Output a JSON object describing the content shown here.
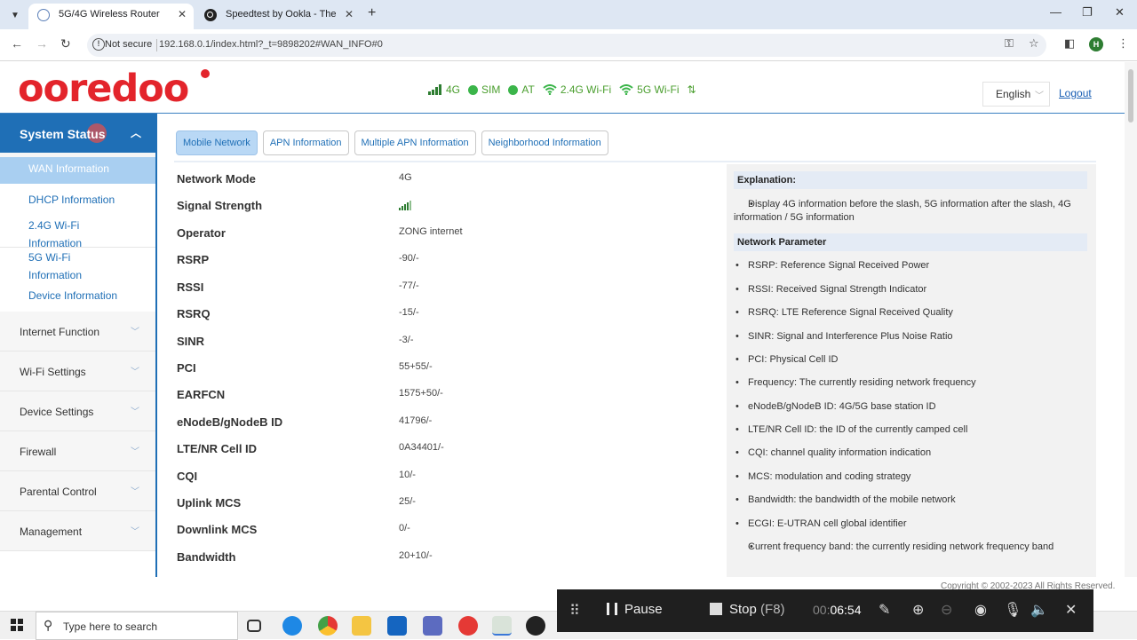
{
  "browser": {
    "tabs": [
      {
        "title": "5G/4G Wireless Router",
        "active": true
      },
      {
        "title": "Speedtest by Ookla - The Globa",
        "active": false
      }
    ],
    "new_tab": "+",
    "close": "✕",
    "window_controls": {
      "minimize": "—",
      "maximize": "❐",
      "close": "✕"
    },
    "security_label": "Not secure",
    "url": "192.168.0.1/index.html?_t=9898202#WAN_INFO#0",
    "profile_initial": "H"
  },
  "header": {
    "logo_text": "ooredoo",
    "status": [
      {
        "label": "4G",
        "icon": "signal-bars-icon"
      },
      {
        "label": "SIM",
        "icon": "green-dot-icon"
      },
      {
        "label": "AT",
        "icon": "green-dot-icon"
      },
      {
        "label": "2.4G Wi-Fi",
        "icon": "wifi-icon"
      },
      {
        "label": "5G Wi-Fi",
        "icon": "wifi-icon"
      }
    ],
    "language": "English",
    "logout": "Logout"
  },
  "sidebar": {
    "section_title": "System Status",
    "sub_items": [
      {
        "label": "WAN Information",
        "active": true
      },
      {
        "label": "DHCP Information"
      },
      {
        "label": "2.4G Wi-Fi\nInformation"
      },
      {
        "label": "5G Wi-Fi\nInformation"
      },
      {
        "label": "Device Information"
      }
    ],
    "items": [
      {
        "label": "Internet Function"
      },
      {
        "label": "Wi-Fi Settings"
      },
      {
        "label": "Device Settings"
      },
      {
        "label": "Firewall"
      },
      {
        "label": "Parental Control"
      },
      {
        "label": "Management"
      }
    ]
  },
  "subtabs": [
    {
      "label": "Mobile Network",
      "active": true
    },
    {
      "label": "APN Information"
    },
    {
      "label": "Multiple APN Information"
    },
    {
      "label": "Neighborhood Information"
    }
  ],
  "params": [
    {
      "key": "Network Mode",
      "value": "4G"
    },
    {
      "key": "Signal Strength",
      "value": ""
    },
    {
      "key": "Operator",
      "value": "ZONG internet"
    },
    {
      "key": "RSRP",
      "value": "-90/-"
    },
    {
      "key": "RSSI",
      "value": "-77/-"
    },
    {
      "key": "RSRQ",
      "value": "-15/-"
    },
    {
      "key": "SINR",
      "value": "-3/-"
    },
    {
      "key": "PCI",
      "value": "55+55/-"
    },
    {
      "key": "EARFCN",
      "value": "1575+50/-"
    },
    {
      "key": "eNodeB/gNodeB ID",
      "value": "41796/-"
    },
    {
      "key": "LTE/NR Cell ID",
      "value": "0A34401/-"
    },
    {
      "key": "CQI",
      "value": "10/-"
    },
    {
      "key": "Uplink MCS",
      "value": "25/-"
    },
    {
      "key": "Downlink MCS",
      "value": "0/-"
    },
    {
      "key": "Bandwidth",
      "value": "20+10/-"
    }
  ],
  "explanation": {
    "title": "Explanation:",
    "text": "Display 4G information before the slash, 5G information after the slash, 4G information / 5G information",
    "param_title": "Network Parameter",
    "items": [
      "RSRP: Reference Signal Received Power",
      "RSSI: Received Signal Strength Indicator",
      "RSRQ: LTE Reference Signal Received Quality",
      "SINR: Signal and Interference Plus Noise Ratio",
      "PCI: Physical Cell ID",
      "Frequency: The currently residing network frequency",
      "eNodeB/gNodeB ID: 4G/5G base station ID",
      "LTE/NR Cell ID: the ID of the currently camped cell",
      "CQI: channel quality information indication",
      "MCS: modulation and coding strategy",
      "Bandwidth: the bandwidth of the mobile network",
      "ECGI: E-UTRAN cell global identifier",
      "Current frequency band: the currently residing network frequency band"
    ]
  },
  "copyright": "Copyright © 2002-2023 All Rights Reserved.",
  "recorder": {
    "pause_label": "Pause",
    "stop_label": "Stop",
    "stop_key": "(F8)",
    "timer_dim": "00:",
    "timer": "06:54"
  },
  "taskbar": {
    "search_placeholder": "Type here to search"
  }
}
